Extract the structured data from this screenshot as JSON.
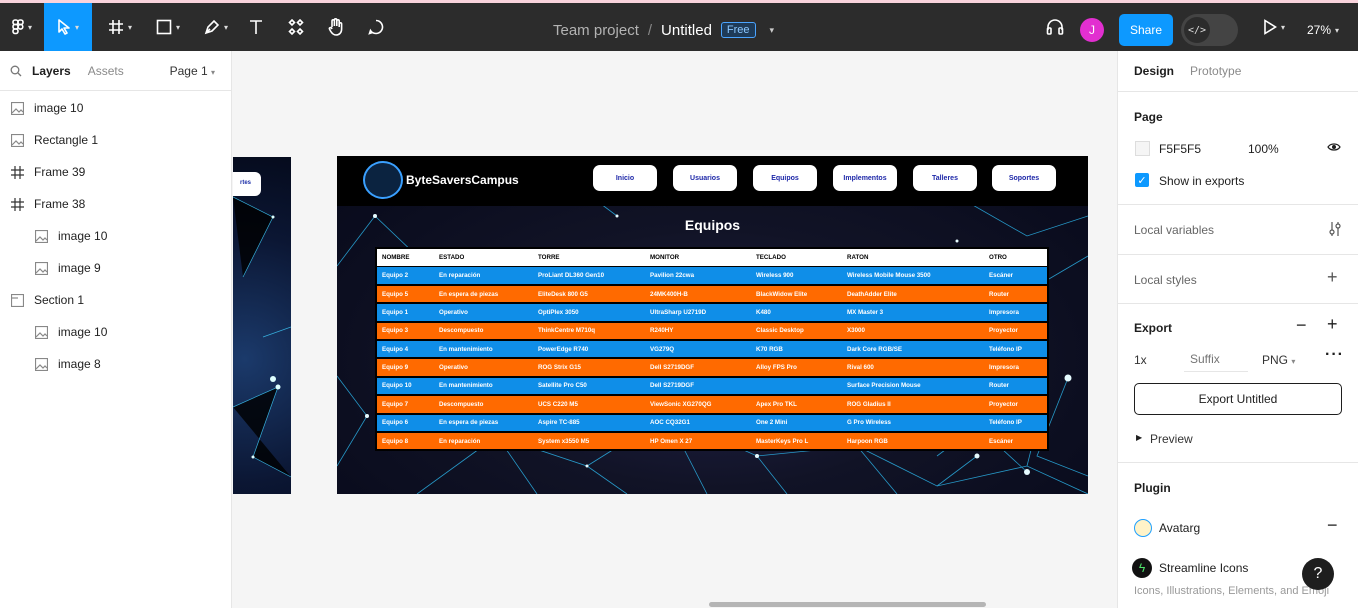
{
  "toolbar": {
    "project": "Team project",
    "separator": "/",
    "file_name": "Untitled",
    "plan_badge": "Free",
    "avatar_initial": "J",
    "share_label": "Share",
    "zoom": "27%",
    "dev_mode_glyph": "</>"
  },
  "layers_panel": {
    "tab_layers": "Layers",
    "tab_assets": "Assets",
    "page_selector": "Page 1",
    "items": [
      {
        "label": "image 10",
        "icon": "image-icon"
      },
      {
        "label": "Rectangle 1",
        "icon": "image-icon"
      },
      {
        "label": "Frame 39",
        "icon": "frame-icon"
      },
      {
        "label": "Frame 38",
        "icon": "frame-icon"
      },
      {
        "label": "image 10",
        "icon": "image-icon"
      },
      {
        "label": "image 9",
        "icon": "image-icon"
      },
      {
        "label": "Section 1",
        "icon": "section-icon"
      },
      {
        "label": "image 10",
        "icon": "image-icon"
      },
      {
        "label": "image 8",
        "icon": "image-icon"
      }
    ]
  },
  "canvas": {
    "left_frame_pill": "rtes",
    "frame": {
      "logo_text": "ByteSaversCampus",
      "nav": [
        "Inicio",
        "Usuarios",
        "Equipos",
        "Implementos",
        "Talleres",
        "Soportes"
      ],
      "heading": "Equipos",
      "table": {
        "headers": [
          "NOMBRE",
          "ESTADO",
          "TORRE",
          "MONITOR",
          "TECLADO",
          "RATON",
          "OTRO"
        ],
        "rows": [
          [
            "Equipo 2",
            "En reparación",
            "ProLiant DL360 Gen10",
            "Pavilion 22cwa",
            "Wireless 900",
            "Wireless Mobile Mouse 3500",
            "Escáner"
          ],
          [
            "Equipo 5",
            "En espera de piezas",
            "EliteDesk 800 G5",
            "24MK400H-B",
            "BlackWidow Elite",
            "DeathAdder Elite",
            "Router"
          ],
          [
            "Equipo 1",
            "Operativo",
            "OptiPlex 3050",
            "UltraSharp U2719D",
            "K480",
            "MX Master 3",
            "Impresora"
          ],
          [
            "Equipo 3",
            "Descompuesto",
            "ThinkCentre M710q",
            "R240HY",
            "Classic Desktop",
            "X3000",
            "Proyector"
          ],
          [
            "Equipo 4",
            "En mantenimiento",
            "PowerEdge R740",
            "VG279Q",
            "K70 RGB",
            "Dark Core RGB/SE",
            "Teléfono IP"
          ],
          [
            "Equipo 9",
            "Operativo",
            "ROG Strix G15",
            "Dell S2719DGF",
            "Alloy FPS Pro",
            "Rival 600",
            "Impresora"
          ],
          [
            "Equipo 10",
            "En mantenimiento",
            "Satellite Pro C50",
            "Dell S2719DGF",
            "",
            "Surface Precision Mouse",
            "Router"
          ],
          [
            "Equipo 7",
            "Descompuesto",
            "UCS C220 M5",
            "ViewSonic XG270QG",
            "Apex Pro TKL",
            "ROG Gladius II",
            "Proyector"
          ],
          [
            "Equipo 6",
            "En espera de piezas",
            "Aspire TC-885",
            "AOC CQ32G1",
            "One 2 Mini",
            "G Pro Wireless",
            "Teléfono IP"
          ],
          [
            "Equipo 8",
            "En reparación",
            "System x3550 M5",
            "HP Omen X 27",
            "MasterKeys Pro L",
            "Harpoon RGB",
            "Escáner"
          ]
        ],
        "row_colors": [
          "#0f8ee8",
          "#ff6a00"
        ]
      }
    }
  },
  "design_panel": {
    "tab_design": "Design",
    "tab_prototype": "Prototype",
    "page_title": "Page",
    "page_color": "F5F5F5",
    "page_opacity": "100%",
    "show_in_exports": "Show in exports",
    "local_variables": "Local variables",
    "local_styles": "Local styles",
    "export_title": "Export",
    "export_scale": "1x",
    "export_suffix_placeholder": "Suffix",
    "export_format": "PNG",
    "export_button": "Export Untitled",
    "preview": "Preview",
    "plugin_title": "Plugin",
    "plugins": [
      {
        "name": "Avatarg"
      },
      {
        "name": "Streamline Icons",
        "description": "Icons, Illustrations, Elements, and Emoji"
      }
    ],
    "help": "?"
  },
  "colors": {
    "toolbar_bg": "#2c2c2c",
    "accent": "#0d99ff",
    "avatar": "#e22fd0"
  }
}
